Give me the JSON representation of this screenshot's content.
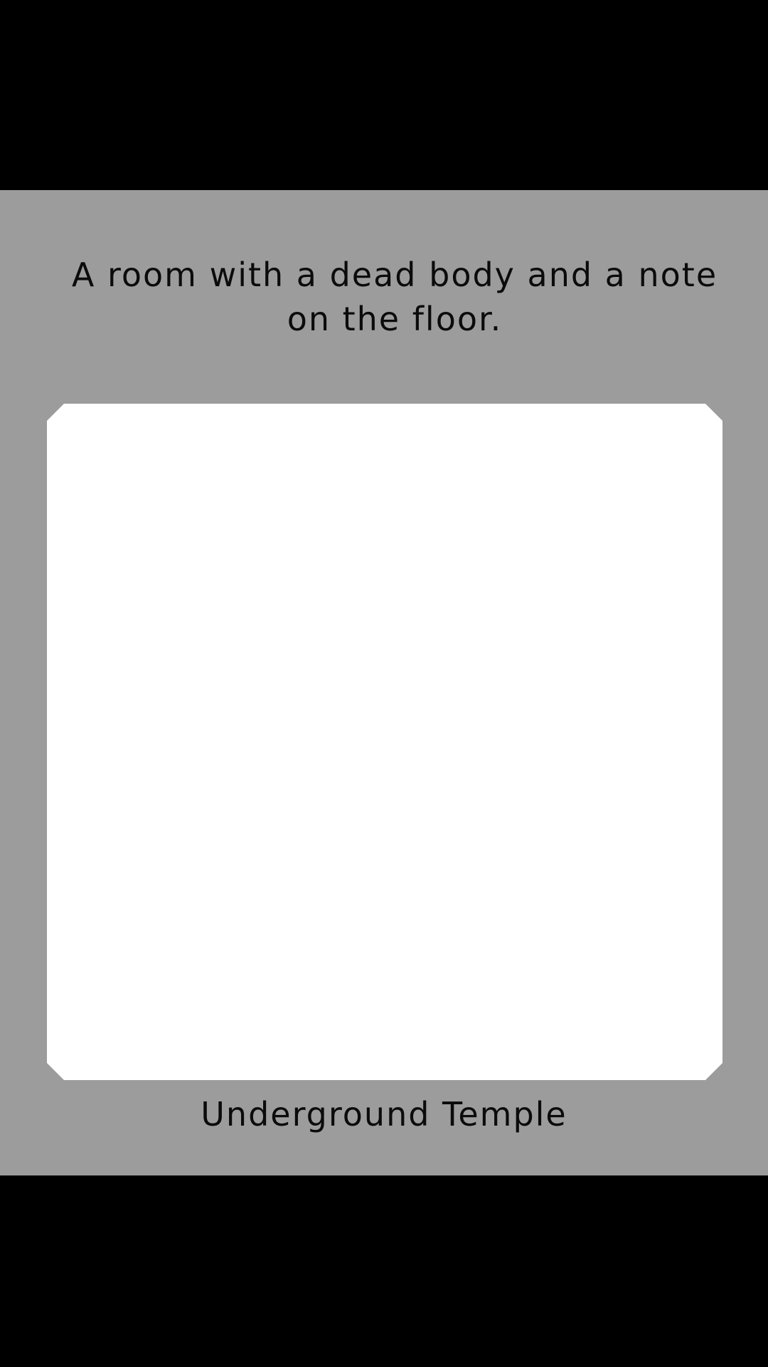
{
  "scene": {
    "description": "A room with a dead body and a note on the floor.",
    "location": "Underground Temple"
  },
  "colors": {
    "letterbox": "#000000",
    "panel_background": "#9c9c9c",
    "scene_frame": "#ffffff",
    "text": "#0b0b0b"
  }
}
